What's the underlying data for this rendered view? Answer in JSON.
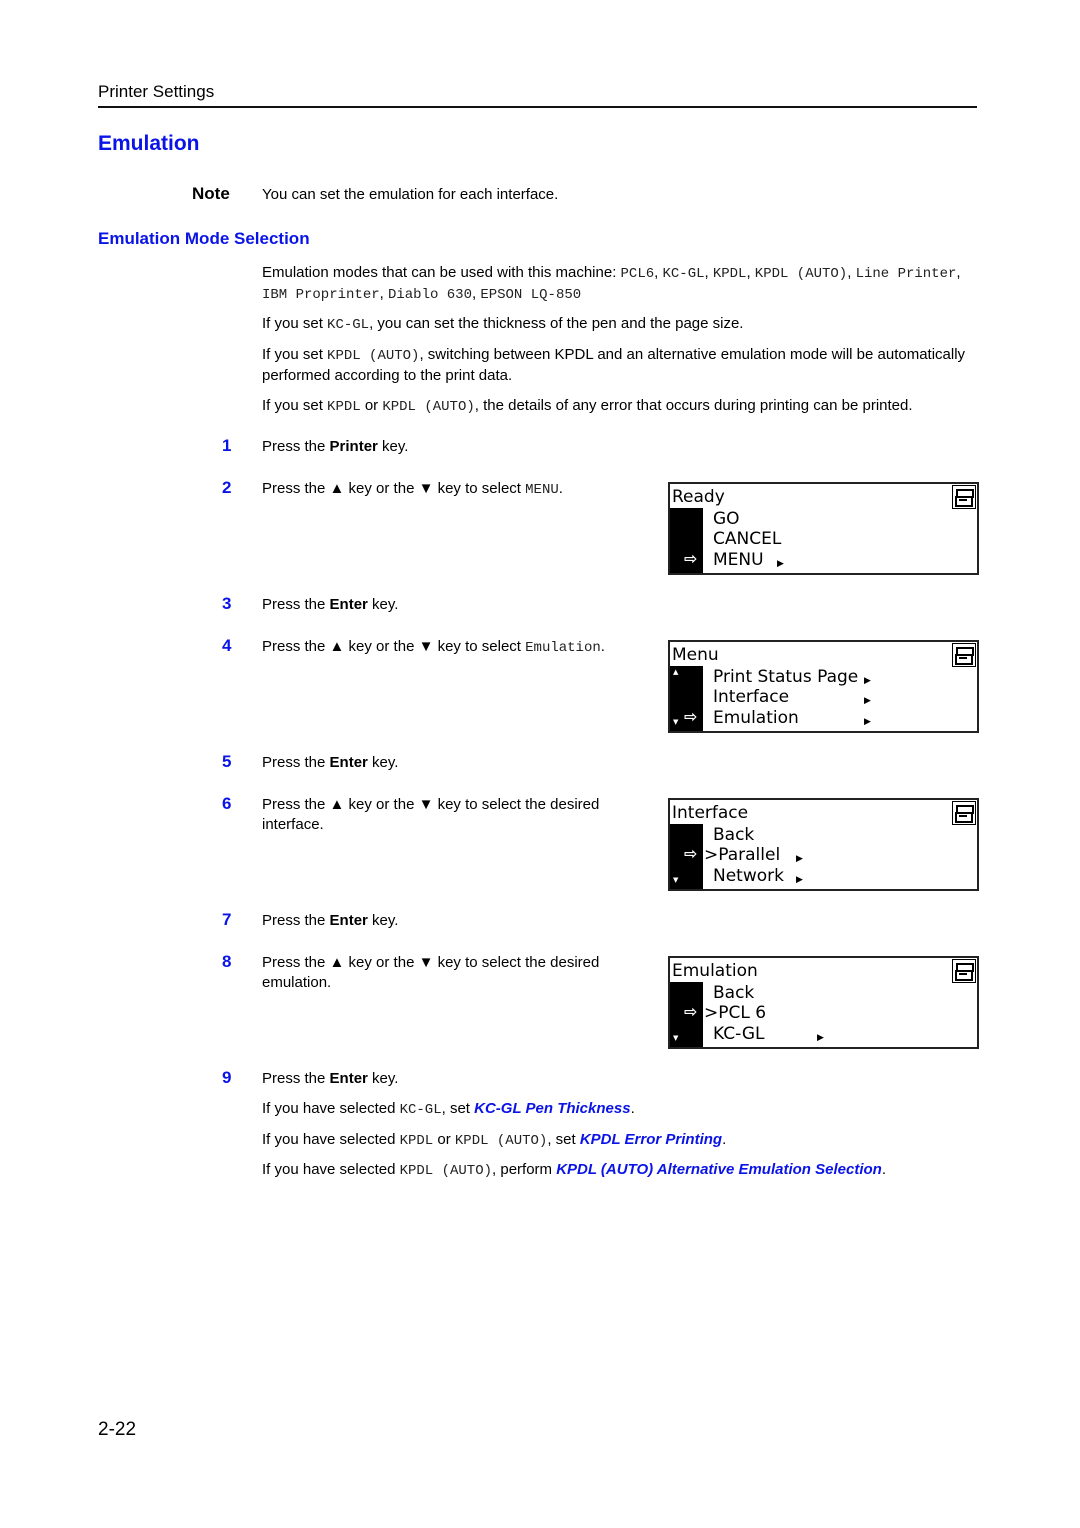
{
  "header": {
    "section": "Printer Settings"
  },
  "title": "Emulation",
  "note": {
    "label": "Note",
    "text": "You can set the emulation for each interface."
  },
  "subtitle": "Emulation Mode Selection",
  "intro": {
    "p1_text": "Emulation modes that can be used with this machine: ",
    "p1_modes": [
      {
        "mode": "PCL6",
        "sep": ", "
      },
      {
        "mode": "KC-GL",
        "sep": ", "
      },
      {
        "mode": "KPDL",
        "sep": ", "
      },
      {
        "mode": "KPDL (AUTO)",
        "sep": ", "
      },
      {
        "mode": "Line Printer",
        "sep": ", "
      },
      {
        "mode": "IBM Proprinter",
        "sep": ", "
      },
      {
        "mode": "Diablo 630",
        "sep": ", "
      },
      {
        "mode": "EPSON LQ-850",
        "sep": ""
      }
    ],
    "p2_pre": "If you set ",
    "p2_code": "KC-GL",
    "p2_post": ", you can set the thickness of the pen and the page size.",
    "p3_pre": "If you set ",
    "p3_code": "KPDL (AUTO)",
    "p3_post": ", switching between KPDL and an alternative emulation mode will be automatically performed according to the print data.",
    "p4_pre": "If you set ",
    "p4_code1": "KPDL",
    "p4_mid": " or ",
    "p4_code2": "KPDL (AUTO)",
    "p4_post": ", the details of any error that occurs during printing can be printed."
  },
  "steps": [
    {
      "num": "1",
      "pre": "Press the ",
      "bold": "Printer",
      "post": " key."
    },
    {
      "num": "2",
      "pre": "Press the ▲ key or the ▼ key to select ",
      "code": "MENU",
      "post": "."
    },
    {
      "num": "3",
      "pre": "Press the ",
      "bold": "Enter",
      "post": " key."
    },
    {
      "num": "4",
      "pre": "Press the ▲ key or the ▼ key to select ",
      "code": "Emulation",
      "post": "."
    },
    {
      "num": "5",
      "pre": "Press the ",
      "bold": "Enter",
      "post": " key."
    },
    {
      "num": "6",
      "text": "Press the ▲ key or the ▼ key to select the desired interface."
    },
    {
      "num": "7",
      "pre": "Press the ",
      "bold": "Enter",
      "post": " key."
    },
    {
      "num": "8",
      "text": "Press the ▲ key or the ▼ key to select the desired emulation."
    },
    {
      "num": "9",
      "pre": "Press the ",
      "bold": "Enter",
      "post": " key."
    }
  ],
  "followups": [
    {
      "pre": "If you have selected ",
      "code": "KC-GL",
      "mid": ", set ",
      "link": "KC-GL Pen Thickness",
      "post": "."
    },
    {
      "pre": "If you have selected ",
      "code": "KPDL",
      "or": " or ",
      "code2": "KPDL (AUTO)",
      "mid": ", set ",
      "link": "KPDL Error Printing",
      "post": "."
    },
    {
      "pre": "If you have selected ",
      "code": "KPDL (AUTO)",
      "mid": ", perform ",
      "link": "KPDL (AUTO) Alternative Emulation Selection",
      "post": "."
    }
  ],
  "lcds": [
    {
      "title": "Ready",
      "lines": [
        {
          "text": "GO",
          "selected": false,
          "submenu": false
        },
        {
          "text": "CANCEL",
          "selected": false,
          "submenu": false
        },
        {
          "text": "MENU",
          "selected": true,
          "submenu": true
        }
      ],
      "scroll_up": false,
      "scroll_down": false
    },
    {
      "title": "Menu",
      "lines": [
        {
          "text": "Print Status Page",
          "selected": false,
          "submenu": true
        },
        {
          "text": "Interface",
          "selected": false,
          "submenu": true
        },
        {
          "text": "Emulation",
          "selected": true,
          "submenu": true
        }
      ],
      "scroll_up": true,
      "scroll_down": true
    },
    {
      "title": "Interface",
      "lines": [
        {
          "text": "Back",
          "selected": false,
          "submenu": false
        },
        {
          "text": ">Parallel",
          "selected": true,
          "submenu": true
        },
        {
          "text": "Network",
          "selected": false,
          "submenu": true
        }
      ],
      "scroll_up": false,
      "scroll_down": true
    },
    {
      "title": "Emulation",
      "lines": [
        {
          "text": "Back",
          "selected": false,
          "submenu": false
        },
        {
          "text": ">PCL 6",
          "selected": true,
          "submenu": false
        },
        {
          "text": "KC-GL",
          "selected": false,
          "submenu": true
        }
      ],
      "scroll_up": false,
      "scroll_down": true
    }
  ],
  "icons": {
    "selection_arrow": "⇨",
    "submenu_marker": "▶",
    "scroll_up": "▲",
    "scroll_down": "▼",
    "printer": "printer-icon"
  },
  "page_number": "2-22",
  "colors": {
    "heading_blue": "#0a14e6",
    "text": "#000000"
  }
}
